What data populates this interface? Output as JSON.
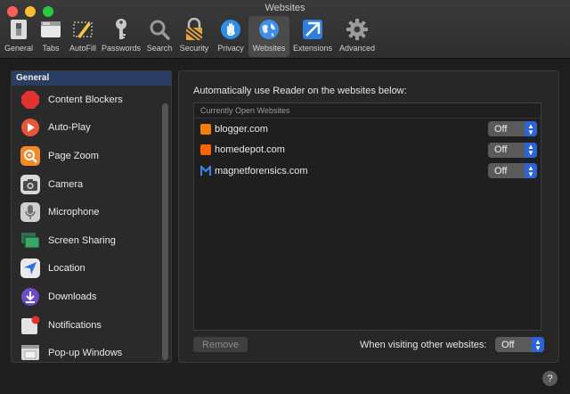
{
  "window": {
    "title": "Websites"
  },
  "toolbar": {
    "tabs": [
      {
        "label": "General",
        "icon": "general-switch-icon"
      },
      {
        "label": "Tabs",
        "icon": "tabs-window-icon"
      },
      {
        "label": "AutoFill",
        "icon": "autofill-pencil-icon"
      },
      {
        "label": "Passwords",
        "icon": "key-icon"
      },
      {
        "label": "Search",
        "icon": "magnifier-icon"
      },
      {
        "label": "Security",
        "icon": "lock-icon"
      },
      {
        "label": "Privacy",
        "icon": "hand-icon"
      },
      {
        "label": "Websites",
        "icon": "globe-icon"
      },
      {
        "label": "Extensions",
        "icon": "extensions-icon"
      },
      {
        "label": "Advanced",
        "icon": "gear-icon"
      }
    ]
  },
  "sidebar": {
    "header": "General",
    "items": [
      {
        "label": "Content Blockers",
        "icon": "stop-sign-icon",
        "color": "#e0322f"
      },
      {
        "label": "Auto-Play",
        "icon": "play-icon",
        "color": "#e8553b"
      },
      {
        "label": "Page Zoom",
        "icon": "zoom-icon",
        "color": "#f08a2a"
      },
      {
        "label": "Camera",
        "icon": "camera-icon",
        "color": "#6e6e6e"
      },
      {
        "label": "Microphone",
        "icon": "microphone-icon",
        "color": "#9a9a9a"
      },
      {
        "label": "Screen Sharing",
        "icon": "screen-sharing-icon",
        "color": "#2e8b57"
      },
      {
        "label": "Location",
        "icon": "location-arrow-icon",
        "color": "#2a6fe0"
      },
      {
        "label": "Downloads",
        "icon": "downloads-icon",
        "color": "#6d4cc6"
      },
      {
        "label": "Notifications",
        "icon": "notifications-icon",
        "color": "#d9d9d9"
      },
      {
        "label": "Pop-up Windows",
        "icon": "popup-windows-icon",
        "color": "#d9d9d9"
      }
    ]
  },
  "main": {
    "heading": "Automatically use Reader on the websites below:",
    "table_header": "Currently Open Websites",
    "sites": [
      {
        "name": "blogger.com",
        "icon": "blogger-icon",
        "color": "#f57d00",
        "setting": "Off"
      },
      {
        "name": "homedepot.com",
        "icon": "homedepot-icon",
        "color": "#f96302",
        "setting": "Off"
      },
      {
        "name": "magnetforensics.com",
        "icon": "magnetforensics-icon",
        "color": "#2a6fd6",
        "setting": "Off"
      }
    ],
    "remove_label": "Remove",
    "other_label": "When visiting other websites:",
    "other_setting": "Off"
  },
  "help": {
    "label": "?"
  }
}
